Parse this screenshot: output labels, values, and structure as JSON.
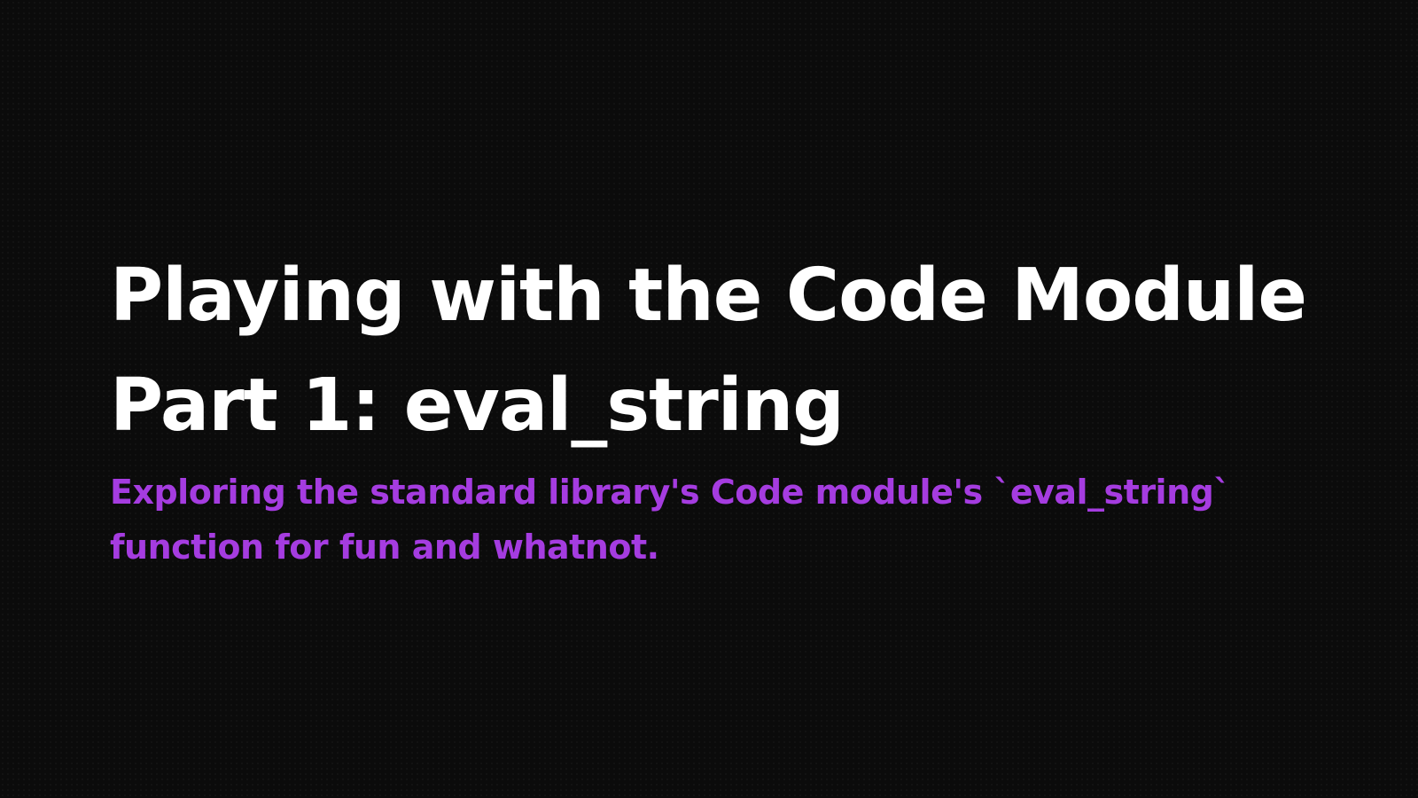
{
  "slide": {
    "title_line_1": "Playing with the Code Module",
    "title_line_2": "Part 1: eval_string",
    "subtitle_line_1": "Exploring the standard library's Code module's `eval_string`",
    "subtitle_line_2": "function for fun and whatnot."
  },
  "colors": {
    "background": "#0b0b0b",
    "title": "#ffffff",
    "subtitle": "#a53ce0"
  }
}
